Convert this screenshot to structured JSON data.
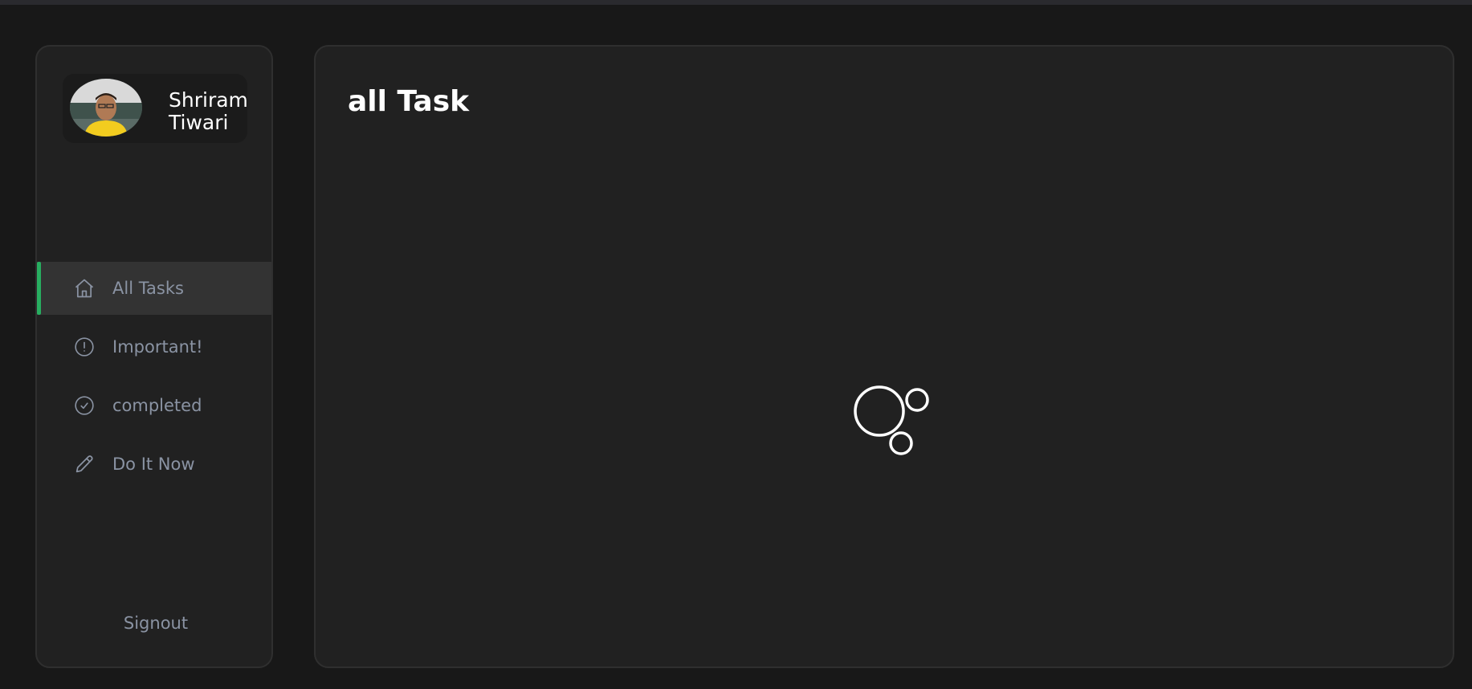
{
  "user": {
    "name": "Shriram Tiwari"
  },
  "nav": {
    "items": [
      {
        "label": "All Tasks",
        "icon": "home-icon",
        "active": true
      },
      {
        "label": "Important!",
        "icon": "alert-circle-icon",
        "active": false
      },
      {
        "label": "completed",
        "icon": "check-circle-icon",
        "active": false
      },
      {
        "label": "Do It Now",
        "icon": "pencil-icon",
        "active": false
      }
    ],
    "signout_label": "Signout"
  },
  "main": {
    "title": "all Task"
  },
  "colors": {
    "background": "#181818",
    "panel": "#212121",
    "active_item": "#333333",
    "accent": "#27ae60",
    "muted_text": "#8a93a3"
  }
}
